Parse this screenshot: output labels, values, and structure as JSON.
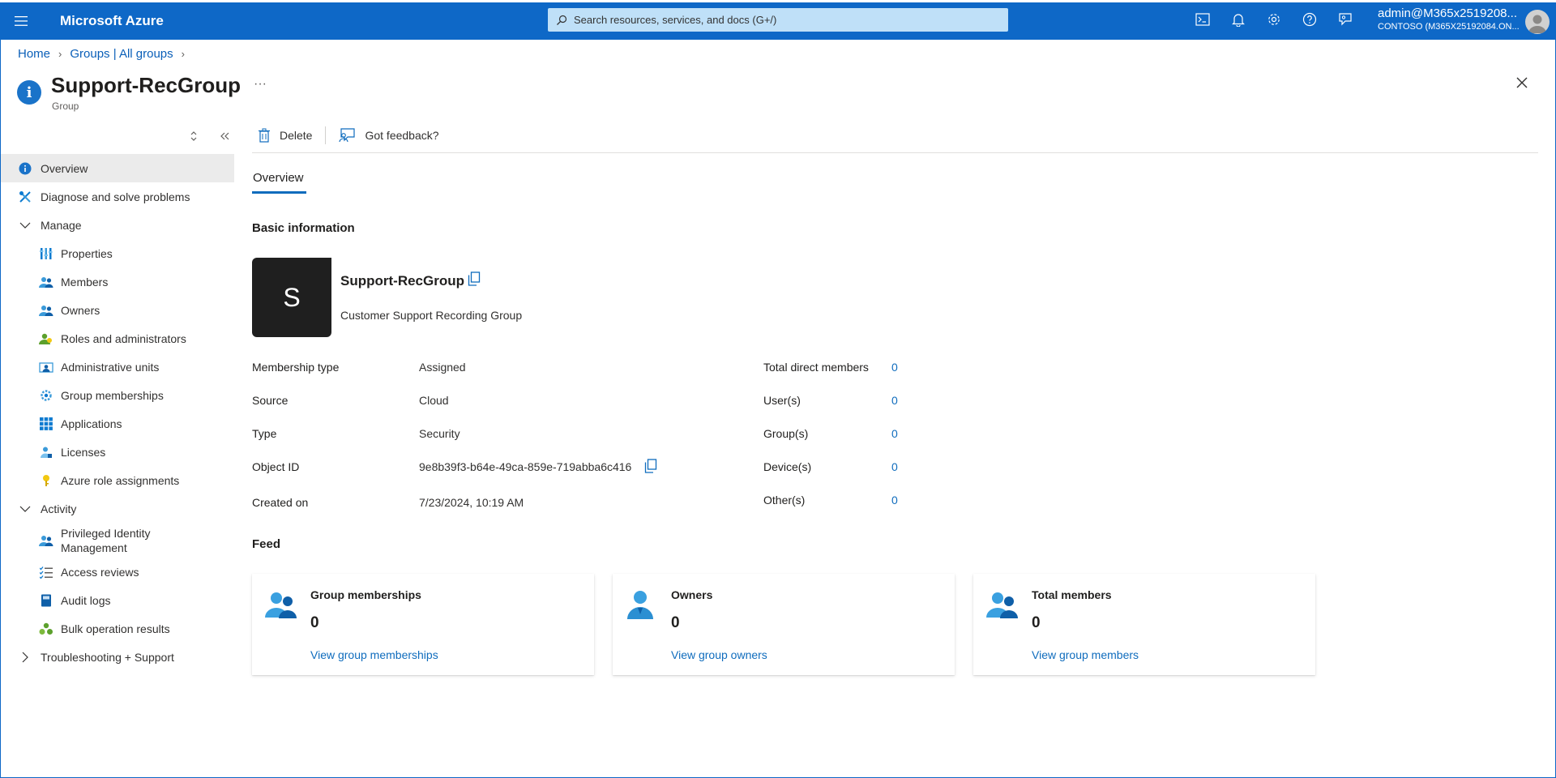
{
  "topbar": {
    "brand": "Microsoft Azure",
    "search_placeholder": "Search resources, services, and docs (G+/)",
    "account_user": "admin@M365x2519208...",
    "account_tenant": "CONTOSO (M365X25192084.ON..."
  },
  "breadcrumb": {
    "home": "Home",
    "groups": "Groups | All groups"
  },
  "header": {
    "title": "Support-RecGroup",
    "subtitle": "Group",
    "more": "···"
  },
  "sidebar": {
    "items": [
      {
        "label": "Overview"
      },
      {
        "label": "Diagnose and solve problems"
      },
      {
        "label": "Manage"
      },
      {
        "label": "Properties"
      },
      {
        "label": "Members"
      },
      {
        "label": "Owners"
      },
      {
        "label": "Roles and administrators"
      },
      {
        "label": "Administrative units"
      },
      {
        "label": "Group memberships"
      },
      {
        "label": "Applications"
      },
      {
        "label": "Licenses"
      },
      {
        "label": "Azure role assignments"
      },
      {
        "label": "Activity"
      },
      {
        "label": "Privileged Identity Management"
      },
      {
        "label": "Access reviews"
      },
      {
        "label": "Audit logs"
      },
      {
        "label": "Bulk operation results"
      },
      {
        "label": "Troubleshooting + Support"
      }
    ]
  },
  "commands": {
    "delete": "Delete",
    "feedback": "Got feedback?"
  },
  "tab": "Overview",
  "basic": {
    "section_title": "Basic information",
    "avatar_letter": "S",
    "name": "Support-RecGroup",
    "description": "Customer Support Recording Group",
    "properties": [
      {
        "label": "Membership type",
        "value": "Assigned"
      },
      {
        "label": "Source",
        "value": "Cloud"
      },
      {
        "label": "Type",
        "value": "Security"
      },
      {
        "label": "Object ID",
        "value": "9e8b39f3-b64e-49ca-859e-719abba6c416"
      },
      {
        "label": "Created on",
        "value": "7/23/2024, 10:19 AM"
      }
    ],
    "counts": [
      {
        "label": "Total direct members",
        "value": "0"
      },
      {
        "label": "User(s)",
        "value": "0"
      },
      {
        "label": "Group(s)",
        "value": "0"
      },
      {
        "label": "Device(s)",
        "value": "0"
      },
      {
        "label": "Other(s)",
        "value": "0"
      }
    ]
  },
  "feed": {
    "section_title": "Feed",
    "cards": [
      {
        "title": "Group memberships",
        "value": "0",
        "link": "View group memberships"
      },
      {
        "title": "Owners",
        "value": "0",
        "link": "View group owners"
      },
      {
        "title": "Total members",
        "value": "0",
        "link": "View group members"
      }
    ]
  },
  "colors": {
    "topbar": "#0e68c7",
    "link": "#0f6cbd",
    "active_nav": "#ebebeb"
  }
}
